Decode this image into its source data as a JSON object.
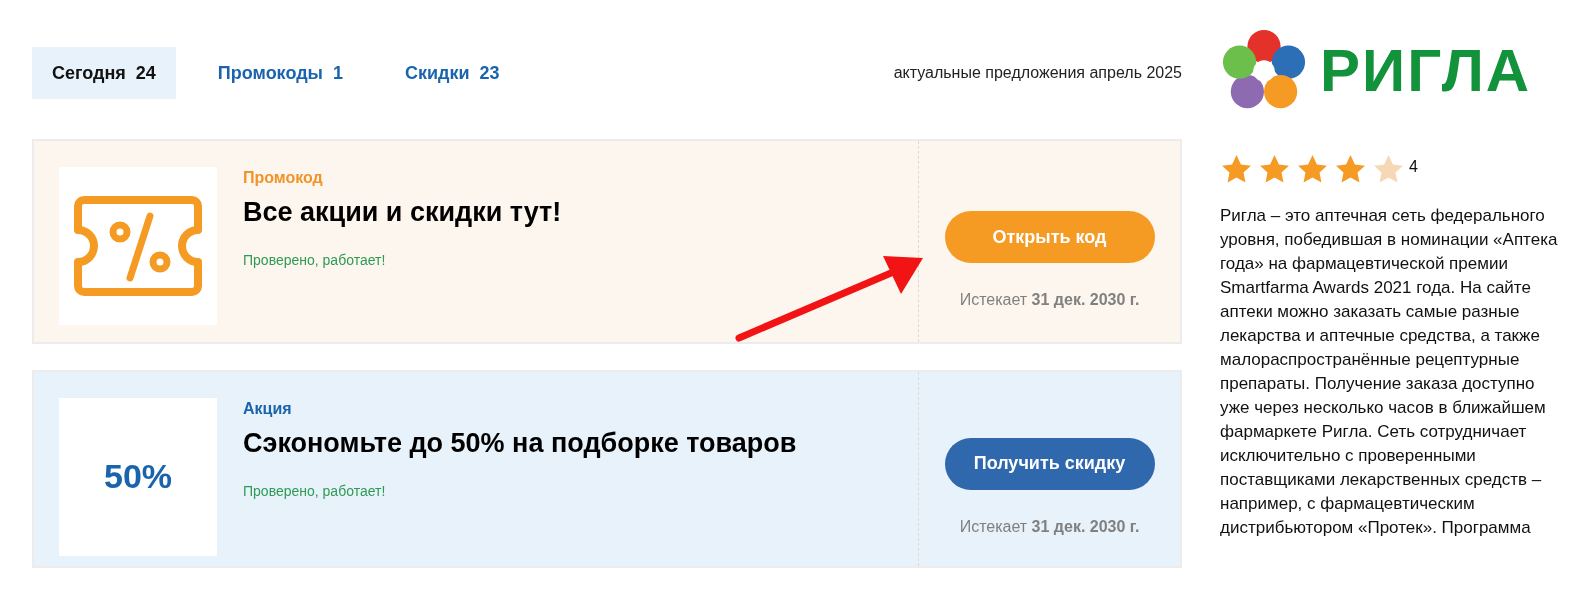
{
  "tabs": [
    {
      "label": "Сегодня",
      "count": "24",
      "selected": true
    },
    {
      "label": "Промокоды",
      "count": "1",
      "selected": false
    },
    {
      "label": "Скидки",
      "count": "23",
      "selected": false
    }
  ],
  "period": "актуальные предложения апрель 2025",
  "offers": [
    {
      "kind": "promo",
      "type_label": "Промокод",
      "title": "Все акции и скидки тут!",
      "verified": "Проверено, работает!",
      "button": "Открыть код",
      "expires": "Истекает **31 дек. 2030 г.**"
    },
    {
      "kind": "deal",
      "badge": "50%",
      "type_label": "Акция",
      "title": "Сэкономьте до 50% на подборке товаров",
      "verified": "Проверено, работает!",
      "button": "Получить скидку",
      "expires": "Истекает **31 дек. 2030 г.**"
    }
  ],
  "sidebar": {
    "logo_text": "РИГЛА",
    "stars": 4,
    "rating": "4",
    "description": "Ригла – это аптечная сеть федерального уровня, победившая в номинации «Аптека года» на фармацевтической премии Smartfarma Awards 2021 года. На сайте аптеки можно заказать самые разные лекарства и аптечные средства, а также малораспространённые рецептурные препараты. Получение заказа доступно уже через несколько часов в ближайшем фармаркете Ригла. Сеть сотрудничает исключительно с проверенными поставщиками лекарственных средств – например, с фармацевтическим дистрибьютором «Протек». Программа"
  }
}
